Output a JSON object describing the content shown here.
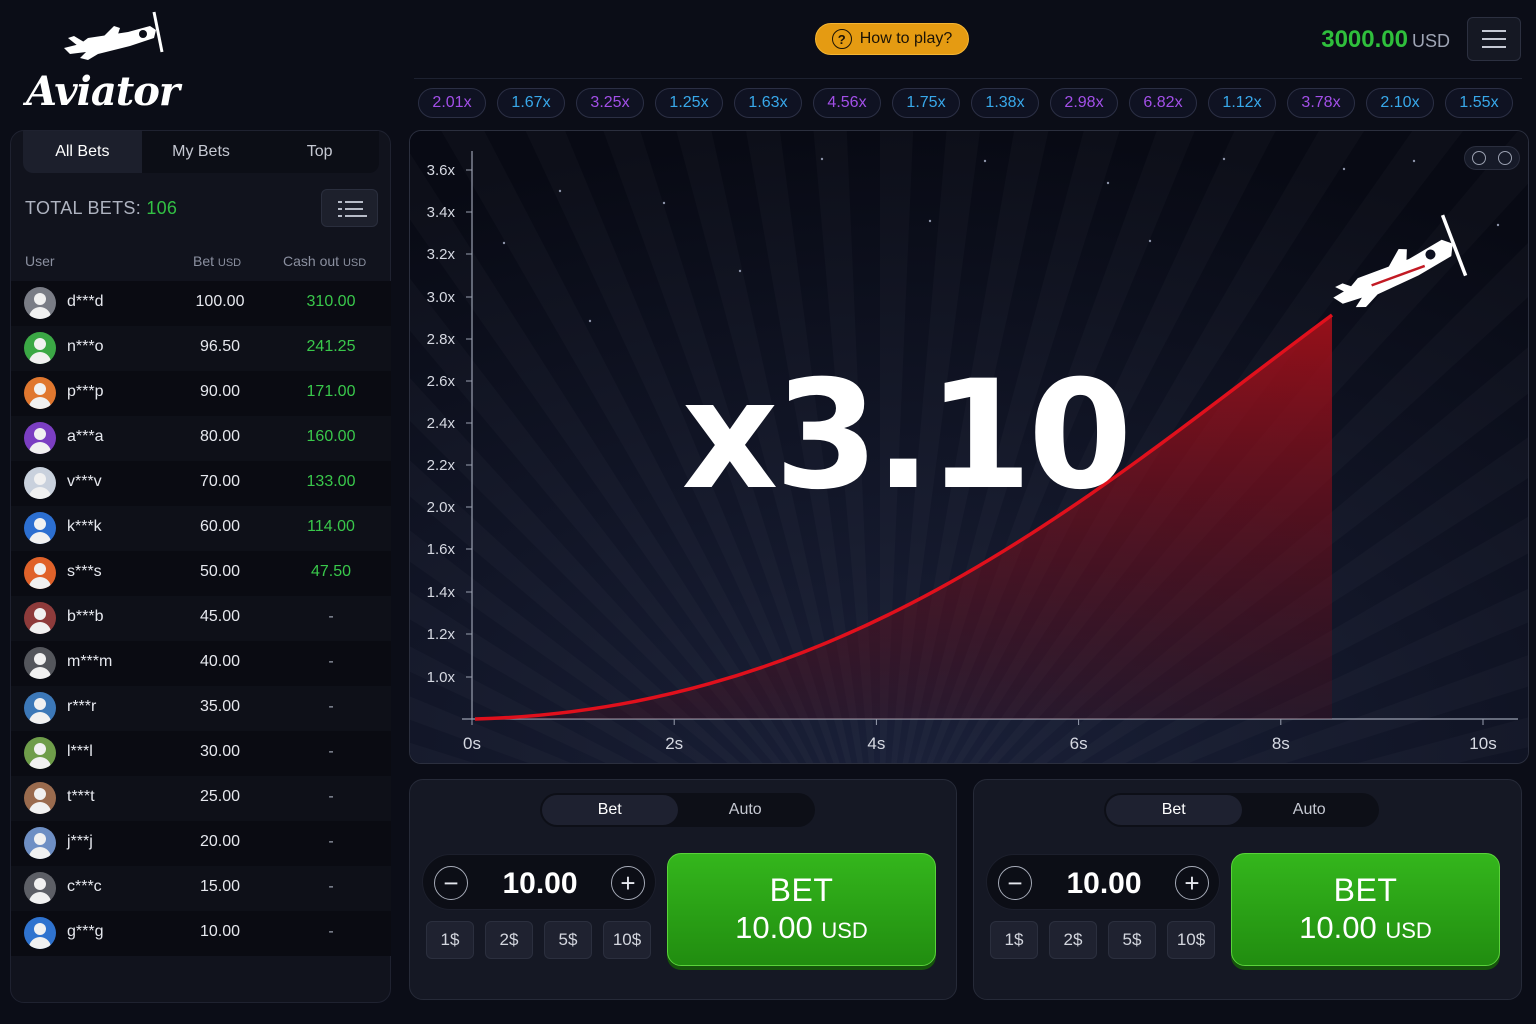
{
  "logo": {
    "text": "Aviator"
  },
  "header": {
    "how_to_play": "How to play?",
    "question_glyph": "?",
    "balance_amount": "3000.00",
    "balance_currency": "USD"
  },
  "history": [
    {
      "label": "2.01x",
      "color": "#a24fe8"
    },
    {
      "label": "1.67x",
      "color": "#38a8ea"
    },
    {
      "label": "3.25x",
      "color": "#a24fe8"
    },
    {
      "label": "1.25x",
      "color": "#38a8ea"
    },
    {
      "label": "1.63x",
      "color": "#38a8ea"
    },
    {
      "label": "4.56x",
      "color": "#a24fe8"
    },
    {
      "label": "1.75x",
      "color": "#38a8ea"
    },
    {
      "label": "1.38x",
      "color": "#38a8ea"
    },
    {
      "label": "2.98x",
      "color": "#a24fe8"
    },
    {
      "label": "6.82x",
      "color": "#a24fe8"
    },
    {
      "label": "1.12x",
      "color": "#38a8ea"
    },
    {
      "label": "3.78x",
      "color": "#a24fe8"
    },
    {
      "label": "2.10x",
      "color": "#38a8ea"
    },
    {
      "label": "1.55x",
      "color": "#38a8ea"
    }
  ],
  "bets_panel": {
    "tabs": [
      "All Bets",
      "My Bets",
      "Top"
    ],
    "active_tab": "All Bets",
    "total_bets_label": "TOTAL BETS:",
    "total_bets_value": "106",
    "col_user": "User",
    "col_bet": "Bet",
    "col_bet_unit": "USD",
    "col_cashout": "Cash out",
    "col_cashout_unit": "USD",
    "rows": [
      {
        "user": "d***d",
        "bet": "100.00",
        "cashout": "310.00",
        "avatar": "#7a7d86"
      },
      {
        "user": "n***o",
        "bet": "96.50",
        "cashout": "241.25",
        "avatar": "#3ba845"
      },
      {
        "user": "p***p",
        "bet": "90.00",
        "cashout": "171.00",
        "avatar": "#e0772f"
      },
      {
        "user": "a***a",
        "bet": "80.00",
        "cashout": "160.00",
        "avatar": "#7b3ec2"
      },
      {
        "user": "v***v",
        "bet": "70.00",
        "cashout": "133.00",
        "avatar": "#c9d1dd"
      },
      {
        "user": "k***k",
        "bet": "60.00",
        "cashout": "114.00",
        "avatar": "#2c6fd1"
      },
      {
        "user": "s***s",
        "bet": "50.00",
        "cashout": "47.50",
        "avatar": "#e0622a"
      },
      {
        "user": "b***b",
        "bet": "45.00",
        "cashout": "-",
        "avatar": "#8e3b3b"
      },
      {
        "user": "m***m",
        "bet": "40.00",
        "cashout": "-",
        "avatar": "#54565c"
      },
      {
        "user": "r***r",
        "bet": "35.00",
        "cashout": "-",
        "avatar": "#3c78b8"
      },
      {
        "user": "l***l",
        "bet": "30.00",
        "cashout": "-",
        "avatar": "#6f9d4a"
      },
      {
        "user": "t***t",
        "bet": "25.00",
        "cashout": "-",
        "avatar": "#9a6b4e"
      },
      {
        "user": "j***j",
        "bet": "20.00",
        "cashout": "-",
        "avatar": "#6e8fc4"
      },
      {
        "user": "c***c",
        "bet": "15.00",
        "cashout": "-",
        "avatar": "#5d5f66"
      },
      {
        "user": "g***g",
        "bet": "10.00",
        "cashout": "-",
        "avatar": "#2f73cf"
      }
    ]
  },
  "game": {
    "multiplier": "x3.10",
    "y_ticks": [
      "3.6x",
      "3.4x",
      "3.2x",
      "3.0x",
      "2.8x",
      "2.6x",
      "2.4x",
      "2.2x",
      "2.0x",
      "1.6x",
      "1.4x",
      "1.2x",
      "1.0x"
    ],
    "x_ticks": [
      "0s",
      "2s",
      "4s",
      "6s",
      "8s",
      "10s"
    ],
    "curve_color": "#e0101c"
  },
  "bet_panels": [
    {
      "tabs": [
        "Bet",
        "Auto"
      ],
      "active": "Bet",
      "amount": "10.00",
      "minus": "−",
      "plus": "+",
      "quick": [
        "1$",
        "2$",
        "5$",
        "10$"
      ],
      "button_title": "BET",
      "button_amount": "10.00",
      "button_currency": "USD"
    },
    {
      "tabs": [
        "Bet",
        "Auto"
      ],
      "active": "Bet",
      "amount": "10.00",
      "minus": "−",
      "plus": "+",
      "quick": [
        "1$",
        "2$",
        "5$",
        "10$"
      ],
      "button_title": "BET",
      "button_amount": "10.00",
      "button_currency": "USD"
    }
  ]
}
